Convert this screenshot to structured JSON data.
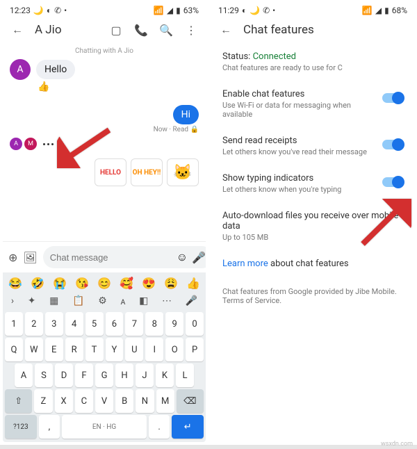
{
  "left": {
    "status": {
      "time": "12:23",
      "battery": "63%"
    },
    "header": {
      "title": "A Jio"
    },
    "sub": "Chatting with A Jio",
    "msgs": {
      "in": "Hello",
      "react": "👍",
      "out": "Hi",
      "meta": "Now · Read 🔒"
    },
    "stickers": [
      "HELLO",
      "OH HEY!!",
      "🐱"
    ],
    "input": {
      "placeholder": "Chat message"
    },
    "avatars": {
      "a": "A",
      "m": "M"
    },
    "emoji_row": [
      "😂",
      "🤣",
      "😭",
      "😘",
      "😊",
      "🥰",
      "😍",
      "😩",
      "👍"
    ],
    "keys": {
      "nums": [
        "1",
        "2",
        "3",
        "4",
        "5",
        "6",
        "7",
        "8",
        "9",
        "0"
      ],
      "r1": [
        "Q",
        "W",
        "E",
        "R",
        "T",
        "Y",
        "U",
        "I",
        "O",
        "P"
      ],
      "r2": [
        "A",
        "S",
        "D",
        "F",
        "G",
        "H",
        "J",
        "K",
        "L"
      ],
      "r3": [
        "Z",
        "X",
        "C",
        "V",
        "B",
        "N",
        "M"
      ],
      "bottom": {
        "sym": "?123",
        "comma": ",",
        "lang": "EN · HG",
        "period": ".",
        "enter": "↵"
      }
    }
  },
  "right": {
    "status": {
      "time": "11:29",
      "battery": "68%"
    },
    "header": {
      "title": "Chat features"
    },
    "status_row": {
      "label": "Status:",
      "value": "Connected",
      "sub": "Chat features are ready to use for C"
    },
    "items": [
      {
        "title": "Enable chat features",
        "sub": "Use Wi-Fi or data for messaging when available"
      },
      {
        "title": "Send read receipts",
        "sub": "Let others know you've read their message"
      },
      {
        "title": "Show typing indicators",
        "sub": "Let others know when you're typing"
      },
      {
        "title": "Auto-download files you receive over mobile data",
        "sub": "Up to 105 MB"
      }
    ],
    "learn": {
      "link": "Learn more",
      "rest": " about chat features"
    },
    "footer": "Chat features from Google provided by Jibe Mobile. Terms of Service."
  },
  "watermark": "wsxdn.com"
}
